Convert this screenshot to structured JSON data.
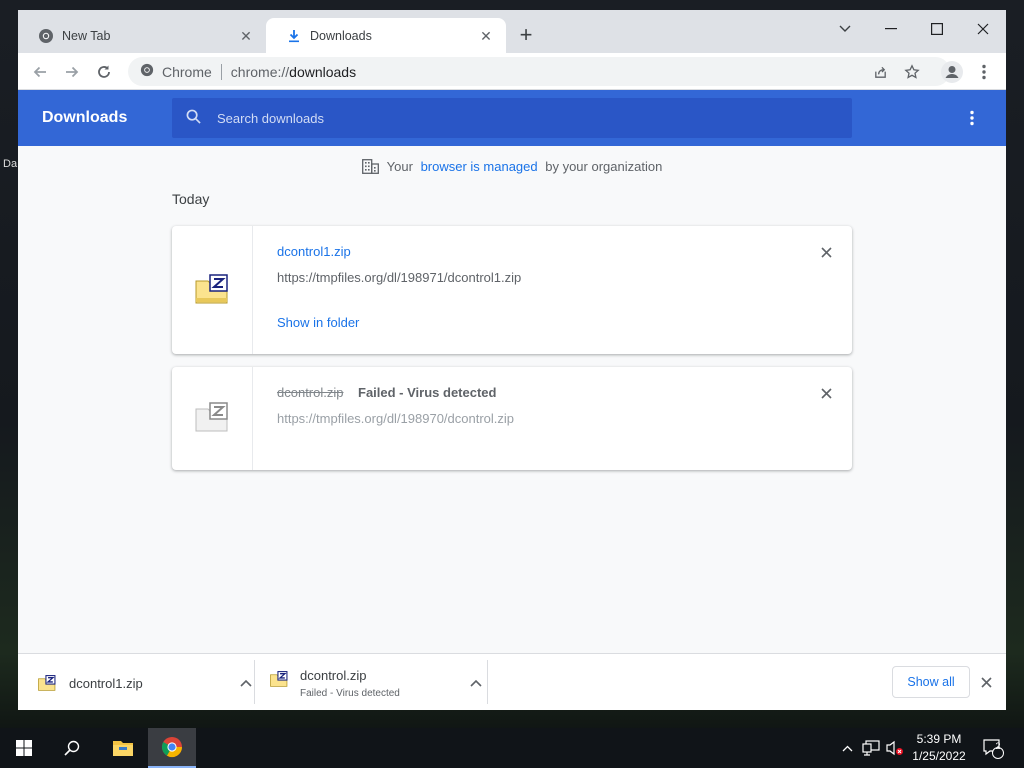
{
  "desktop": {
    "label_fragment": "Da"
  },
  "browser": {
    "tabs": [
      {
        "title": "New Tab",
        "active": false
      },
      {
        "title": "Downloads",
        "active": true
      }
    ],
    "omnibox": {
      "scheme_label": "Chrome",
      "url_prefix": "chrome://",
      "url_path": "downloads"
    }
  },
  "downloads_page": {
    "title": "Downloads",
    "search_placeholder": "Search downloads",
    "managed_notice": {
      "prefix": "Your ",
      "link": "browser is managed",
      "suffix": " by your organization"
    },
    "section_label": "Today",
    "items": [
      {
        "filename": "dcontrol1.zip",
        "url": "https://tmpfiles.org/dl/198971/dcontrol1.zip",
        "action": "Show in folder",
        "status": ""
      },
      {
        "filename": "dcontrol.zip",
        "url": "https://tmpfiles.org/dl/198970/dcontrol.zip",
        "action": "",
        "status": "Failed - Virus detected"
      }
    ]
  },
  "download_shelf": {
    "items": [
      {
        "filename": "dcontrol1.zip",
        "status": ""
      },
      {
        "filename": "dcontrol.zip",
        "status": "Failed - Virus detected"
      }
    ],
    "show_all_label": "Show all"
  },
  "taskbar": {
    "time": "5:39 PM",
    "date": "1/25/2022",
    "notification_count": "2"
  },
  "colors": {
    "accent": "#3367d6",
    "link": "#1a73e8"
  }
}
